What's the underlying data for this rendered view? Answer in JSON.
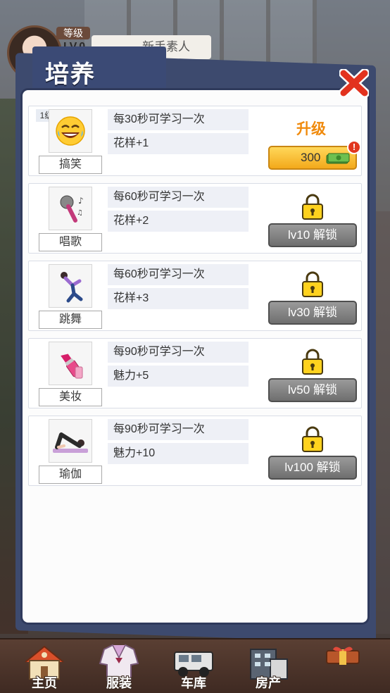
{
  "hud": {
    "level_tag": "等级",
    "level_value": "LV.0",
    "title": "新手素人"
  },
  "panel": {
    "title": "培养",
    "close_icon": "close-x-icon"
  },
  "items": [
    {
      "icon": "laughing-emoji-icon",
      "name": "搞笑",
      "level_badge": "1级",
      "line1": "每30秒可学习一次",
      "line2": "花样+1",
      "state": "upgrade",
      "upgrade_label": "升级",
      "cost": "300",
      "alert": "!"
    },
    {
      "icon": "microphone-icon",
      "name": "唱歌",
      "line1": "每60秒可学习一次",
      "line2": "花样+2",
      "state": "locked",
      "unlock_label": "lv10 解锁"
    },
    {
      "icon": "dancer-icon",
      "name": "跳舞",
      "line1": "每60秒可学习一次",
      "line2": "花样+3",
      "state": "locked",
      "unlock_label": "lv30 解锁"
    },
    {
      "icon": "lipstick-icon",
      "name": "美妆",
      "line1": "每90秒可学习一次",
      "line2": "魅力+5",
      "state": "locked",
      "unlock_label": "lv50 解锁"
    },
    {
      "icon": "yoga-icon",
      "name": "瑜伽",
      "line1": "每90秒可学习一次",
      "line2": "魅力+10",
      "state": "locked",
      "unlock_label": "lv100 解锁"
    }
  ],
  "nav": [
    {
      "label": "主页",
      "icon": "house-icon"
    },
    {
      "label": "服装",
      "icon": "uniform-icon"
    },
    {
      "label": "车库",
      "icon": "jeep-icon"
    },
    {
      "label": "房产",
      "icon": "building-icon"
    },
    {
      "label": "",
      "icon": "gift-box-icon"
    }
  ],
  "colors": {
    "upgrade_text": "#f08a0c",
    "upgrade_button": "#f3a91b",
    "locked_button": "#7a7a7a",
    "panel_frame": "#3b4a75"
  }
}
